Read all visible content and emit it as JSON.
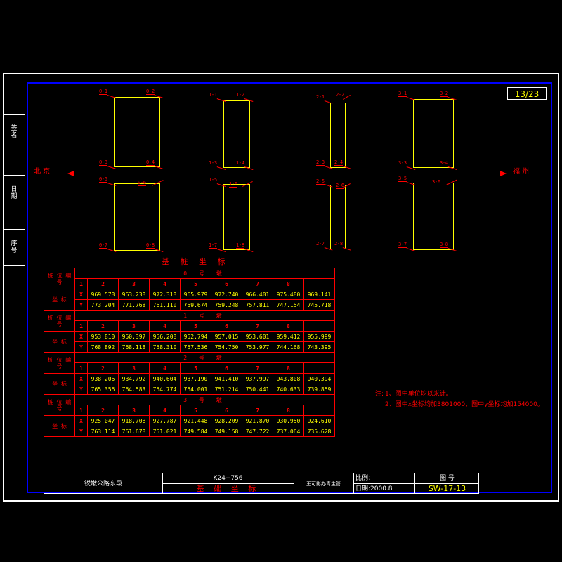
{
  "sheet": {
    "page_number": "13/23",
    "bg_color": "#000000",
    "frame_color": "#ffffff",
    "inner_frame_color": "#0000ff",
    "line_color_red": "#ff0000",
    "line_color_yellow": "#ffff00"
  },
  "margin_tabs": [
    {
      "name": "tab-1",
      "line1": "签",
      "line2": "名"
    },
    {
      "name": "tab-2",
      "line1": "日",
      "line2": "期"
    },
    {
      "name": "tab-3",
      "line1": "序",
      "line2": "号"
    }
  ],
  "drawing": {
    "axis_label_left": "北  京",
    "axis_label_right": "福    州",
    "piles": [
      {
        "group": "0",
        "corners": [
          "0-1",
          "0-2",
          "0-3",
          "0-4",
          "0-5",
          "0-6",
          "0-7",
          "0-8"
        ]
      },
      {
        "group": "1",
        "corners": [
          "1-1",
          "1-2",
          "1-3",
          "1-4",
          "1-5",
          "1-6",
          "1-7",
          "1-8"
        ]
      },
      {
        "group": "2",
        "corners": [
          "2-1",
          "2-2",
          "2-3",
          "2-4",
          "2-5",
          "2-6",
          "2-7",
          "2-8"
        ]
      },
      {
        "group": "3",
        "corners": [
          "3-1",
          "3-2",
          "3-3",
          "3-4",
          "3-5",
          "3-6",
          "3-7",
          "3-8"
        ]
      }
    ]
  },
  "table": {
    "title": "基 桩 坐 标",
    "pile_no_label": "桩 位 编 号",
    "coord_label": "坐 标",
    "axis_x": "X",
    "axis_y": "Y",
    "columns": [
      "1",
      "2",
      "3",
      "4",
      "5",
      "6",
      "7",
      "8"
    ],
    "groups": [
      {
        "group_label": "0  号  墩",
        "x": [
          "969.578",
          "963.238",
          "972.318",
          "965.979",
          "972.740",
          "966.401",
          "975.480",
          "969.141"
        ],
        "y": [
          "773.204",
          "771.768",
          "761.110",
          "759.674",
          "759.248",
          "757.811",
          "747.154",
          "745.718"
        ]
      },
      {
        "group_label": "1  号  墩",
        "x": [
          "953.810",
          "950.397",
          "956.208",
          "952.794",
          "957.015",
          "953.601",
          "959.412",
          "955.999"
        ],
        "y": [
          "768.892",
          "768.118",
          "758.310",
          "757.536",
          "754.750",
          "753.977",
          "744.168",
          "743.395"
        ]
      },
      {
        "group_label": "2  号  墩",
        "x": [
          "938.206",
          "934.792",
          "940.604",
          "937.190",
          "941.410",
          "937.997",
          "943.808",
          "940.394"
        ],
        "y": [
          "765.356",
          "764.583",
          "754.774",
          "754.001",
          "751.214",
          "750.441",
          "740.633",
          "739.859"
        ]
      },
      {
        "group_label": "3  号  墩",
        "x": [
          "925.047",
          "918.708",
          "927.787",
          "921.448",
          "928.209",
          "921.870",
          "930.950",
          "924.610"
        ],
        "y": [
          "763.114",
          "761.678",
          "751.021",
          "749.584",
          "749.158",
          "747.722",
          "737.064",
          "735.628"
        ]
      }
    ]
  },
  "notes": {
    "head": "注:",
    "lines": [
      "1、图中单位均以米计。",
      "2、图中x坐标均加3801000，图中y坐标均加154000。"
    ]
  },
  "title_block": {
    "project": "锐嫩公路东段",
    "station": "K24+756",
    "drawing_name": "基 础 坐 标",
    "designer": "王可影办青主管",
    "scale_label": "比例：",
    "scale_value": "",
    "date_label": "日期:",
    "date_value": "2000.8",
    "sheet_label": "图    号",
    "sheet_value": "SW-17-13"
  }
}
